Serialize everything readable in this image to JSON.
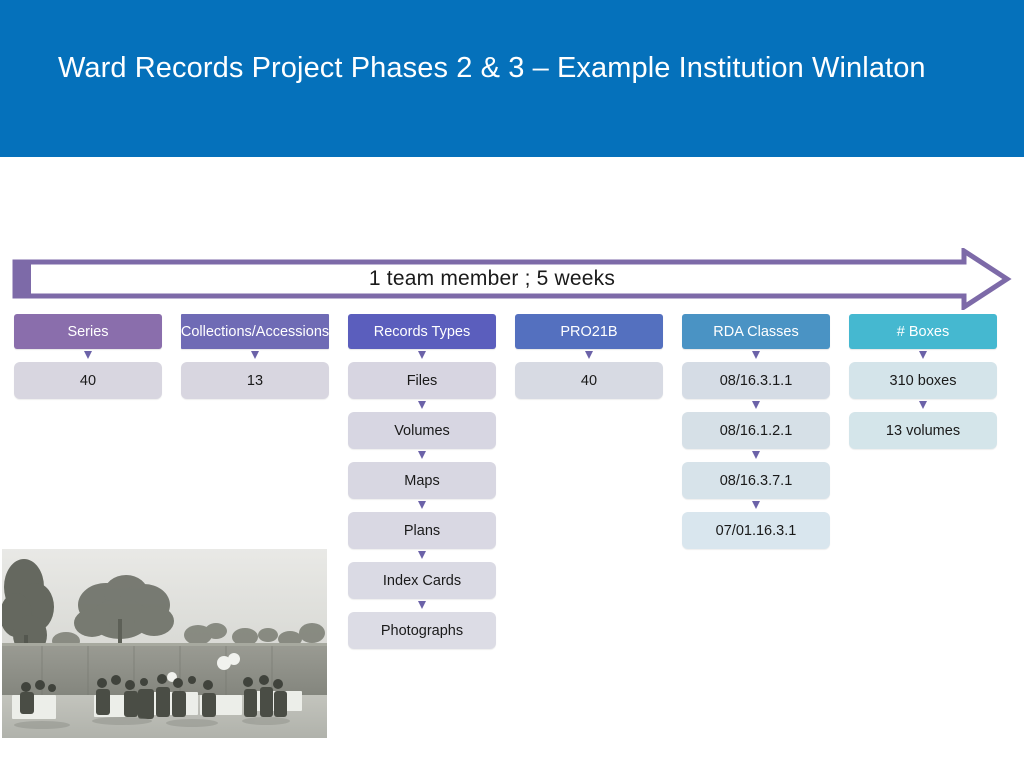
{
  "slide": {
    "title": "Ward Records Project Phases 2 & 3 – Example Institution Winlaton",
    "background_color": "#ffffff"
  },
  "banner": {
    "background_color": "#0571bb",
    "title_color": "#ffffff"
  },
  "arrow": {
    "label": "1 team member ; 5 weeks",
    "stroke_color": "#7d6aa8",
    "fill_color": "#ffffff",
    "direction": "right"
  },
  "columns": [
    {
      "header": "Series",
      "header_color": "#8a6eac",
      "cells": [
        {
          "text": "40",
          "color": "#d8d6e0"
        }
      ]
    },
    {
      "header": "Collections/Accessions",
      "header_color": "#6f6bb5",
      "two_line": true,
      "cells": [
        {
          "text": "13",
          "color": "#d8d6e0"
        }
      ]
    },
    {
      "header": "Records Types",
      "header_color": "#5b5ebd",
      "cells": [
        {
          "text": "Files",
          "color": "#d7d5e1"
        },
        {
          "text": "Volumes",
          "color": "#d7d6e2"
        },
        {
          "text": "Maps",
          "color": "#d8d7e2"
        },
        {
          "text": "Plans",
          "color": "#d9d8e3"
        },
        {
          "text": "Index Cards",
          "color": "#dadae4"
        },
        {
          "text": "Photographs",
          "color": "#dcdce5"
        }
      ]
    },
    {
      "header": "PRO21B",
      "header_color": "#5470bf",
      "cells": [
        {
          "text": "40",
          "color": "#d7dae3"
        }
      ]
    },
    {
      "header": "RDA Classes",
      "header_color": "#4a93c4",
      "cells": [
        {
          "text": "08/16.3.1.1",
          "color": "#d5dce5"
        },
        {
          "text": "08/16.1.2.1",
          "color": "#d6e0e7"
        },
        {
          "text": "08/16.3.7.1",
          "color": "#d7e3ea"
        },
        {
          "text": "07/01.16.3.1",
          "color": "#d9e6ee"
        }
      ]
    },
    {
      "header": "# Boxes",
      "header_color": "#45b8d0",
      "cells": [
        {
          "text": "310 boxes",
          "color": "#d4e4ea"
        },
        {
          "text": "13 volumes",
          "color": "#d4e5ea"
        }
      ]
    }
  ],
  "photo": {
    "caption": "",
    "description": "black-and-white photograph of people seated at outdoor tables with trees and a fence"
  }
}
